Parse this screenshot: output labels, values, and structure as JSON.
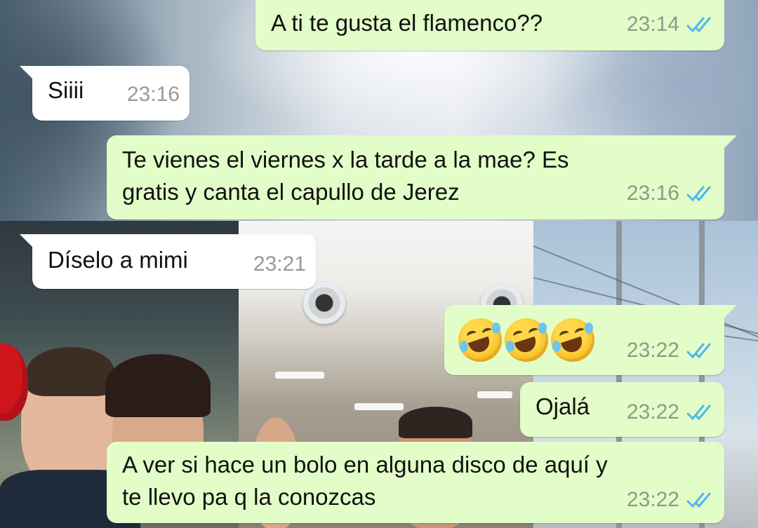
{
  "chat": {
    "messages": [
      {
        "direction": "outgoing",
        "text": "A ti te gusta el flamenco??",
        "time": "23:14",
        "status": "read"
      },
      {
        "direction": "incoming",
        "text": "Siiii",
        "time": "23:16"
      },
      {
        "direction": "outgoing",
        "text_lines": [
          "Te vienes el viernes x la tarde a la mae? Es",
          "gratis y canta el capullo de Jerez"
        ],
        "time": "23:16",
        "status": "read"
      },
      {
        "direction": "incoming",
        "text": "Díselo a mimi",
        "time": "23:21"
      },
      {
        "direction": "outgoing",
        "emoji": "rolling-on-the-floor-laughing x3",
        "time": "23:22",
        "status": "read"
      },
      {
        "direction": "outgoing",
        "text": "Ojalá",
        "time": "23:22",
        "status": "read"
      },
      {
        "direction": "outgoing",
        "text_lines": [
          "A ver si hace un bolo en alguna disco de aquí y",
          "te llevo pa q la conozcas"
        ],
        "time": "23:22",
        "status": "read"
      }
    ]
  },
  "colors": {
    "outgoing_bubble": "#e2fdc8",
    "incoming_bubble": "#ffffff",
    "read_ticks": "#4fb6ec",
    "timestamp": "#8b9a8a"
  },
  "icons": {
    "read_receipt": "double-check-icon",
    "emoji": "rolling-on-the-floor-laughing-emoji"
  }
}
